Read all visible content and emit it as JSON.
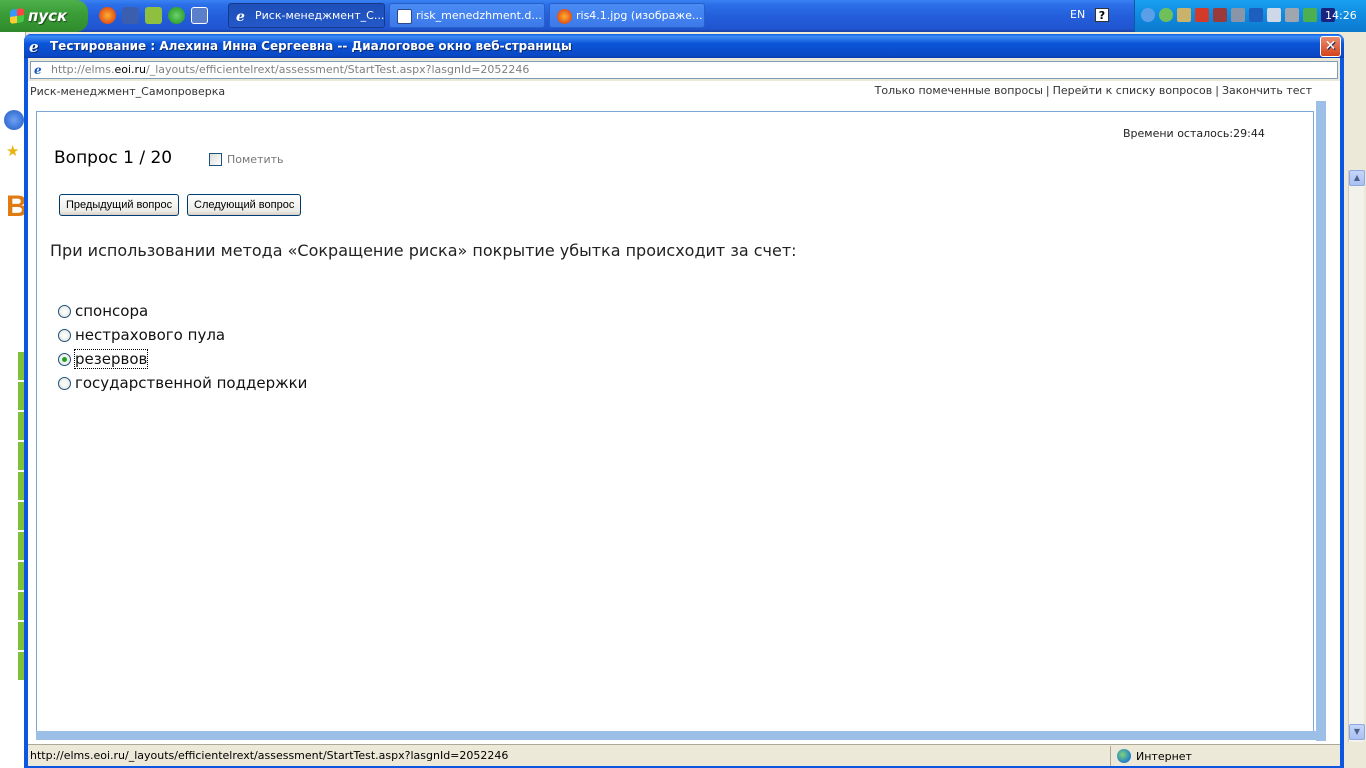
{
  "taskbar": {
    "start_label": "пуск",
    "tasks": [
      {
        "label": "Риск-менеджмент_С...",
        "active": true
      },
      {
        "label": "risk_menedzhment.d...",
        "active": false
      },
      {
        "label": "ris4.1.jpg (изображе...",
        "active": false
      }
    ],
    "lang": "EN",
    "help": "?",
    "clock": "14:26"
  },
  "dialog": {
    "title": "Тестирование : Алехина Инна Сергеевна -- Диалоговое окно веб-страницы",
    "close_glyph": "✕",
    "address_pre": "http://elms.",
    "address_domain": "eoi.ru",
    "address_post": "/_layouts/efficientelrext/assessment/StartTest.aspx?lasgnId=2052246"
  },
  "page": {
    "breadcrumb": "Риск-менеджмент_Самопроверка",
    "links": {
      "marked": "Только помеченные вопросы",
      "list": "Перейти к списку вопросов",
      "finish": "Закончить тест",
      "sep": "|"
    },
    "timer": "Времени осталось:29:44",
    "question_title": "Вопрос 1 / 20",
    "mark_label": "Пометить",
    "prev_button": "Предыдущий вопрос",
    "next_button": "Следующий вопрос",
    "question_text": "При использовании метода «Сокращение риска» покрытие убытка происходит за счет:",
    "options": [
      {
        "label": "спонсора",
        "selected": false
      },
      {
        "label": "нестрахового пула",
        "selected": false
      },
      {
        "label": "резервов",
        "selected": true
      },
      {
        "label": "государственной поддержки",
        "selected": false
      }
    ]
  },
  "status": {
    "url": "http://elms.eoi.ru/_layouts/efficientelrext/assessment/StartTest.aspx?lasgnId=2052246",
    "zone": "Интернет"
  },
  "colors": {
    "titlebar": "#0a48c6",
    "close": "#d5421c",
    "radio_selected": "#21a121"
  }
}
